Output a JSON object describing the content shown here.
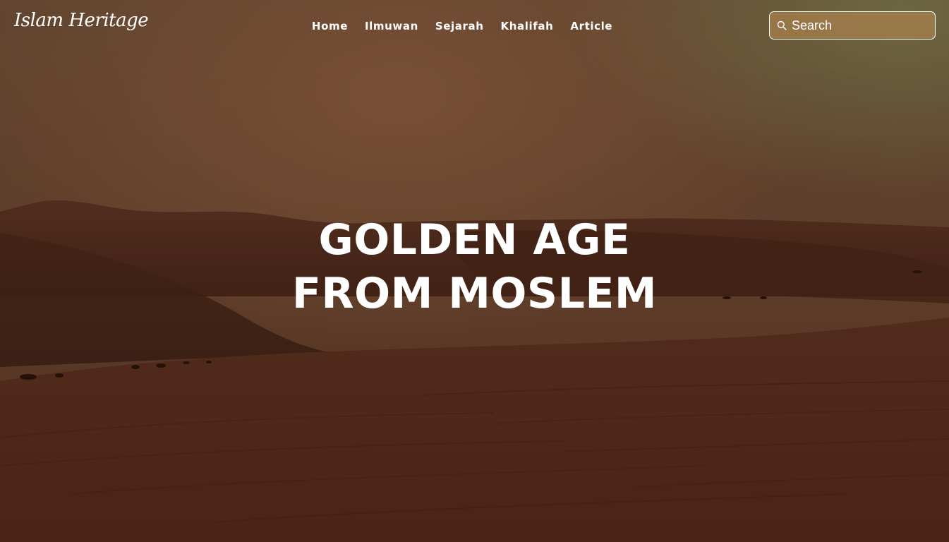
{
  "brand": {
    "logo_text": "Islam Heritage"
  },
  "nav": {
    "items": [
      {
        "label": "Home"
      },
      {
        "label": "Ilmuwan"
      },
      {
        "label": "Sejarah"
      },
      {
        "label": "Khalifah"
      },
      {
        "label": "Article"
      }
    ]
  },
  "search": {
    "placeholder": "Search",
    "value": "",
    "icon": "search-icon"
  },
  "hero": {
    "title_line_1": "GOLDEN AGE",
    "title_line_2": "FROM MOSLEM",
    "background": "desert-dunes-photo"
  },
  "colors": {
    "text": "#ffffff",
    "sky_top": "#7a5a3c",
    "sand": "#5b2f1c",
    "search_bg": "#b88c58"
  }
}
